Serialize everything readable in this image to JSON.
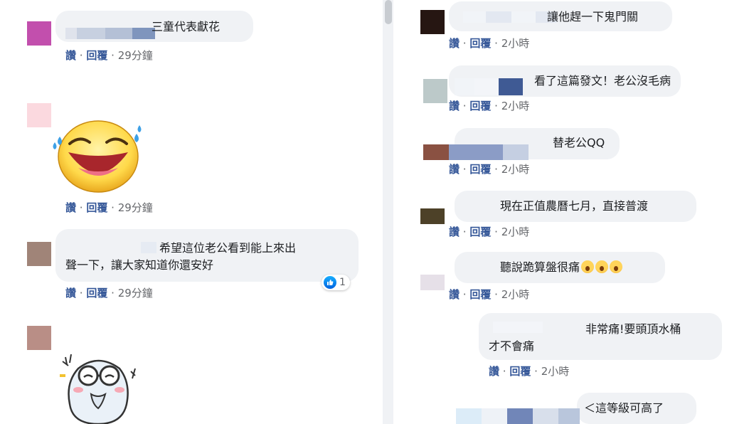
{
  "actions": {
    "like": "讚",
    "reply": "回覆",
    "sep": "·"
  },
  "left_comments": [
    {
      "text": "三童代表獻花",
      "time": "29分鐘"
    },
    {
      "sticker": "laughing-tears-emoji",
      "time": "29分鐘"
    },
    {
      "text_line1": "希望這位老公看到能上來出",
      "text_line2": "聲一下，讓大家知道你還安好",
      "reaction_count": "1",
      "time": "29分鐘"
    },
    {
      "sticker": "hamster-glasses-sticker"
    }
  ],
  "right_comments": [
    {
      "text": "讓他趕一下鬼門關",
      "time": "2小時"
    },
    {
      "text": "看了這篇發文！老公沒毛病",
      "time": "2小時"
    },
    {
      "text": "替老公QQ",
      "time": "2小時"
    },
    {
      "text": "現在正值農曆七月，直接普渡",
      "time": "2小時"
    },
    {
      "text": "聽說跪算盤很痛",
      "emoji": "open-mouth-emoji",
      "emoji_count": 3,
      "time": "2小時"
    },
    {
      "text_line1": "非常痛!要頭頂水桶",
      "text_line2": "才不會痛",
      "time": "2小時"
    },
    {
      "text": "＜這等級可高了"
    }
  ],
  "colors": {
    "link": "#365899",
    "bubble": "#f0f2f5",
    "muted": "#65676b",
    "like_blue": "#1877f2"
  }
}
